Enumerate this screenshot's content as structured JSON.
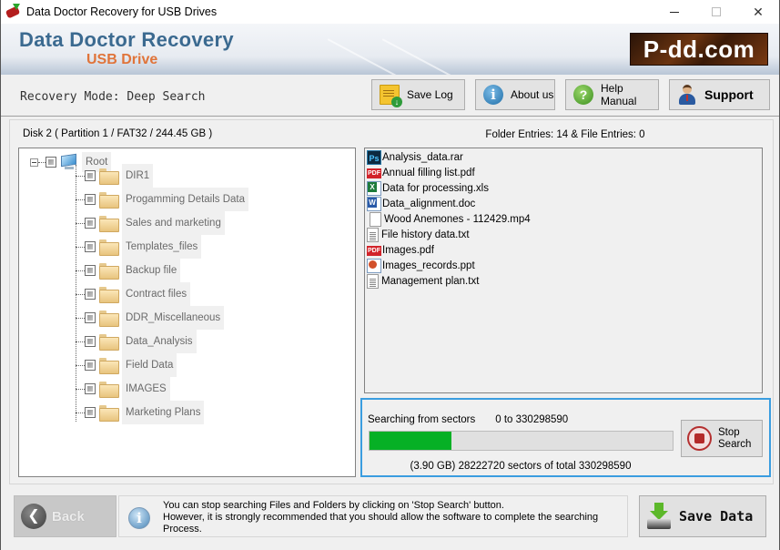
{
  "window": {
    "title": "Data Doctor Recovery for USB Drives",
    "controls": {
      "minimize": "minimize",
      "maximize": "maximize",
      "close": "✕"
    }
  },
  "banner": {
    "brand_main": "Data Doctor Recovery",
    "brand_sub": "USB Drive",
    "logo_text": "P-dd.com"
  },
  "toolbar": {
    "mode_label": "Recovery Mode: Deep Search",
    "buttons": [
      {
        "label": "Save Log",
        "icon": "save-log-icon"
      },
      {
        "label": "About us",
        "icon": "info-icon"
      },
      {
        "label": "Help Manual",
        "icon": "help-icon"
      },
      {
        "label": "Support",
        "icon": "support-person-icon"
      }
    ]
  },
  "disk": {
    "label": "Disk 2 ( Partition 1 / FAT32 / 244.45 GB )",
    "entries_summary": "Folder Entries: 14 & File Entries: 0"
  },
  "tree": {
    "root": "Root",
    "folders": [
      "DIR1",
      "Progamming Details Data",
      "Sales and marketing",
      "Templates_files",
      "Backup file",
      "Contract files",
      "DDR_Miscellaneous",
      "Data_Analysis",
      "Field Data",
      "IMAGES",
      "Marketing Plans"
    ]
  },
  "files": [
    {
      "name": "Analysis_data.rar",
      "type": "ps",
      "icon_text": "Ps"
    },
    {
      "name": "Annual filling list.pdf",
      "type": "pdf",
      "icon_text": "PDF"
    },
    {
      "name": "Data for processing.xls",
      "type": "xls",
      "icon_text": ""
    },
    {
      "name": "Data_alignment.doc",
      "type": "doc",
      "icon_text": ""
    },
    {
      "name": "Wood Anemones - 112429.mp4",
      "type": "blank",
      "icon_text": ""
    },
    {
      "name": "File history data.txt",
      "type": "txt",
      "icon_text": ""
    },
    {
      "name": "Images.pdf",
      "type": "pdf",
      "icon_text": "PDF"
    },
    {
      "name": "Images_records.ppt",
      "type": "ppt",
      "icon_text": ""
    },
    {
      "name": "Management plan.txt",
      "type": "txt",
      "icon_text": ""
    }
  ],
  "progress": {
    "search_label": "Searching from sectors",
    "search_range": "0 to 330298590",
    "percent": 27,
    "sectors_text": "(3.90 GB) 28222720   sectors  of  total 330298590",
    "stop_label": "Stop Search",
    "bar_color": "#06b025",
    "highlight_color": "#3a9de0"
  },
  "footer": {
    "back_label": "Back",
    "info_lines": [
      "You can stop searching Files and Folders by clicking on 'Stop Search' button.",
      "However, it is strongly recommended that you should allow the software to complete the searching",
      "Process."
    ],
    "save_label": "Save Data"
  }
}
